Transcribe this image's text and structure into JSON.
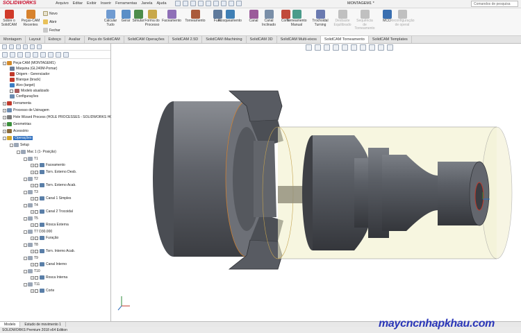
{
  "app": {
    "logo": "SOLIDWORKS",
    "menus": [
      "Arquivo",
      "Editar",
      "Exibir",
      "Inserir",
      "Ferramentas",
      "Janela",
      "Ajuda"
    ],
    "document_title": "MONTAGEM1 *",
    "search_placeholder": "Comandos de pesquisa"
  },
  "ribbon": {
    "left_buttons": [
      {
        "label": "Sobre o SolidCAM"
      },
      {
        "label": "Peças-CAM Recentes"
      }
    ],
    "file_buttons": [
      "Novo",
      "Abrir",
      "Fechar"
    ],
    "buttons": [
      {
        "label": "Calcular Tudo",
        "disabled": false
      },
      {
        "label": "Gerar",
        "disabled": false
      },
      {
        "label": "Simular",
        "disabled": false
      },
      {
        "label": "Forma do Processo",
        "disabled": false
      },
      {
        "label": "Faceamento",
        "disabled": false
      },
      {
        "label": "Torneamento",
        "disabled": false
      },
      {
        "label": "Furo",
        "disabled": false
      },
      {
        "label": "Rosqueamento",
        "disabled": false
      },
      {
        "label": "Canal",
        "disabled": false
      },
      {
        "label": "Canal Inclinado",
        "disabled": false
      },
      {
        "label": "Corte",
        "disabled": false
      },
      {
        "label": "Torneamento Manual",
        "disabled": false
      },
      {
        "label": "Trochoidal Turning",
        "disabled": false
      },
      {
        "label": "Desbaste Equilibrado",
        "disabled": true
      },
      {
        "label": "Sequência de Torneamento",
        "disabled": true
      },
      {
        "label": "MCO",
        "disabled": false
      },
      {
        "label": "Reconfiguração de operal",
        "disabled": true
      }
    ]
  },
  "tabs": [
    {
      "label": "Montagem",
      "active": false
    },
    {
      "label": "Layout",
      "active": false
    },
    {
      "label": "Esboço",
      "active": false
    },
    {
      "label": "Avaliar",
      "active": false
    },
    {
      "label": "Peça do SolidCAM",
      "active": false
    },
    {
      "label": "SolidCAM Operações",
      "active": false
    },
    {
      "label": "SolidCAM 2.5D",
      "active": false
    },
    {
      "label": "SolidCAM iMachining",
      "active": false
    },
    {
      "label": "SolidCAM 3D",
      "active": false
    },
    {
      "label": "SolidCAM Multi-eixos",
      "active": false
    },
    {
      "label": "SolidCAM Torneamento",
      "active": true
    },
    {
      "label": "SolidCAM Templates",
      "active": false
    }
  ],
  "tree": [
    {
      "label": "Peça-CAM (MONTAGEM1)",
      "level": 0,
      "exp": "-",
      "chk": false,
      "color": "#d38a2a"
    },
    {
      "label": "Máquina (GL240M-Pomar)",
      "level": 1,
      "exp": "",
      "chk": false,
      "color": "#6b7d99"
    },
    {
      "label": "Origem - Gerenciador",
      "level": 1,
      "exp": "",
      "chk": false,
      "color": "#c0392b"
    },
    {
      "label": "Blanque (brack)",
      "level": 1,
      "exp": "",
      "chk": false,
      "color": "#c0392b"
    },
    {
      "label": "Alvo (target)",
      "level": 1,
      "exp": "",
      "chk": false,
      "color": "#3c7dc4"
    },
    {
      "label": "Modelo atualizado",
      "level": 1,
      "exp": "",
      "chk": true,
      "color": "#a95c5c"
    },
    {
      "label": "Configurações",
      "level": 1,
      "exp": "",
      "chk": false,
      "color": "#6b8bb0"
    },
    {
      "label": "Ferramenta",
      "level": 0,
      "exp": "+",
      "chk": false,
      "color": "#c0392b"
    },
    {
      "label": "Processo de Usinagem",
      "level": 0,
      "exp": "+",
      "chk": false,
      "color": "#6b8bb0"
    },
    {
      "label": "Hole Wizard Process (HOLE PROCESSES - SOLIDWORKS HOLE",
      "level": 0,
      "exp": "+",
      "chk": false,
      "color": "#7a7a7a"
    },
    {
      "label": "Geometrias",
      "level": 0,
      "exp": "+",
      "chk": false,
      "color": "#3a8f3a"
    },
    {
      "label": "Acessório",
      "level": 0,
      "exp": "+",
      "chk": false,
      "color": "#8a6a3a"
    },
    {
      "label": "Operações",
      "level": 0,
      "exp": "-",
      "chk": false,
      "color": "#d3a52a",
      "selected": true
    },
    {
      "label": "Setup",
      "level": 1,
      "exp": "-",
      "chk": false,
      "color": "#9aa6b6"
    },
    {
      "label": "Mac 1 (1- Posição)",
      "level": 2,
      "exp": "-",
      "chk": false,
      "color": "#9aa6b6"
    },
    {
      "label": "T1",
      "level": 3,
      "exp": "-",
      "chk": false,
      "color": "#9aa6b6"
    },
    {
      "label": "Faceamento",
      "level": 4,
      "exp": "+",
      "chk": true,
      "color": "#5a7fa8"
    },
    {
      "label": "Torn. Externo Desb.",
      "level": 4,
      "exp": "+",
      "chk": true,
      "color": "#5a7fa8"
    },
    {
      "label": "T2",
      "level": 3,
      "exp": "-",
      "chk": false,
      "color": "#9aa6b6"
    },
    {
      "label": "Torn. Externo Acab.",
      "level": 4,
      "exp": "+",
      "chk": true,
      "color": "#5a7fa8"
    },
    {
      "label": "T3",
      "level": 3,
      "exp": "-",
      "chk": false,
      "color": "#9aa6b6"
    },
    {
      "label": "Canal 1 Simples",
      "level": 4,
      "exp": "+",
      "chk": true,
      "color": "#5a7fa8"
    },
    {
      "label": "T4",
      "level": 3,
      "exp": "-",
      "chk": false,
      "color": "#9aa6b6"
    },
    {
      "label": "Canal 2 Trocoidal",
      "level": 4,
      "exp": "+",
      "chk": true,
      "color": "#5a7fa8"
    },
    {
      "label": "T5",
      "level": 3,
      "exp": "-",
      "chk": false,
      "color": "#9aa6b6"
    },
    {
      "label": "Rosca Externa",
      "level": 4,
      "exp": "+",
      "chk": true,
      "color": "#5a7fa8"
    },
    {
      "label": "T7 D30.000",
      "level": 3,
      "exp": "-",
      "chk": false,
      "color": "#9aa6b6"
    },
    {
      "label": "Furação",
      "level": 4,
      "exp": "+",
      "chk": true,
      "color": "#5a7fa8"
    },
    {
      "label": "T8",
      "level": 3,
      "exp": "-",
      "chk": false,
      "color": "#9aa6b6"
    },
    {
      "label": "Torn. Interno Acab.",
      "level": 4,
      "exp": "+",
      "chk": true,
      "color": "#5a7fa8"
    },
    {
      "label": "T9",
      "level": 3,
      "exp": "-",
      "chk": false,
      "color": "#9aa6b6"
    },
    {
      "label": "Canal Interno",
      "level": 4,
      "exp": "+",
      "chk": true,
      "color": "#5a7fa8"
    },
    {
      "label": "T10",
      "level": 3,
      "exp": "-",
      "chk": false,
      "color": "#9aa6b6"
    },
    {
      "label": "Rosca Interna",
      "level": 4,
      "exp": "+",
      "chk": true,
      "color": "#5a7fa8"
    },
    {
      "label": "T11",
      "level": 3,
      "exp": "-",
      "chk": false,
      "color": "#9aa6b6"
    },
    {
      "label": "Corte",
      "level": 4,
      "exp": "+",
      "chk": true,
      "color": "#5a7fa8"
    }
  ],
  "bottom_tabs": [
    "Modelo",
    "Estudo de movimento 1"
  ],
  "status": "SOLIDWORKS Premium 2018 x64 Edition",
  "watermark": "maycncnhapkhau.com",
  "colors": {
    "accent": "#2e6fbf",
    "part": "#5b5f66",
    "stock": "#f2f0cc"
  }
}
